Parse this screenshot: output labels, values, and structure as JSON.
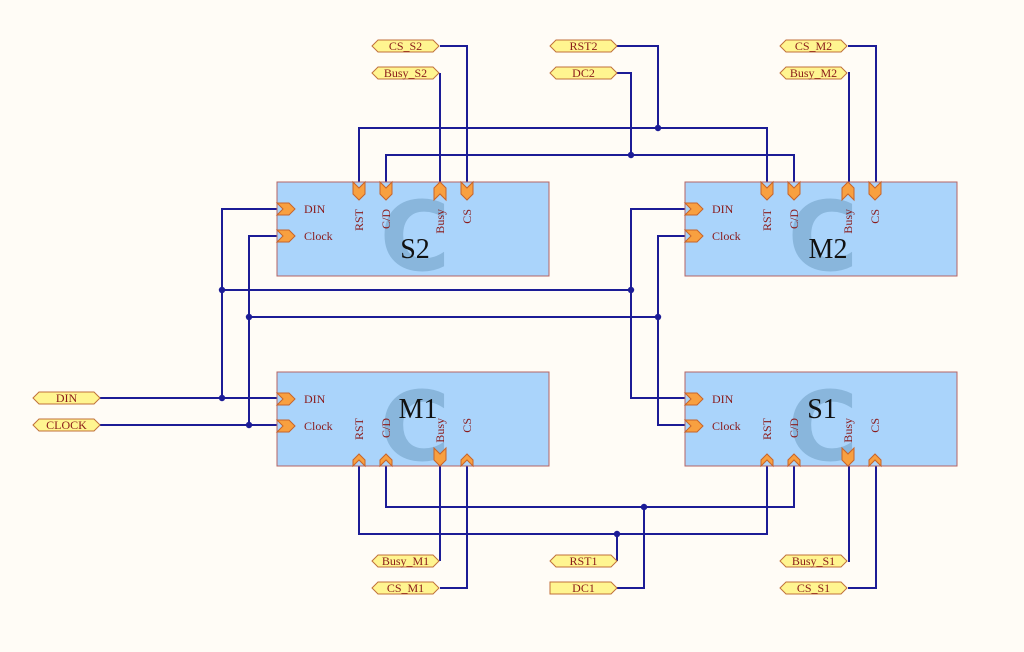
{
  "colors": {
    "wire": "#1c1c96",
    "block_fill": "#aad4fb",
    "block_border": "#b46464",
    "pin": "#f8a040",
    "port_fill": "#fff590",
    "label": "#8a1a1a"
  },
  "watermark": "C",
  "blocks": [
    {
      "name": "S2",
      "pins": {
        "left": [
          "DIN",
          "Clock"
        ],
        "side": [
          "RST",
          "C/D",
          "Busy",
          "CS"
        ]
      }
    },
    {
      "name": "M2",
      "pins": {
        "left": [
          "DIN",
          "Clock"
        ],
        "side": [
          "RST",
          "C/D",
          "Busy",
          "CS"
        ]
      }
    },
    {
      "name": "M1",
      "pins": {
        "left": [
          "DIN",
          "Clock"
        ],
        "side": [
          "RST",
          "C/D",
          "Busy",
          "CS"
        ]
      }
    },
    {
      "name": "S1",
      "pins": {
        "left": [
          "DIN",
          "Clock"
        ],
        "side": [
          "RST",
          "C/D",
          "Busy",
          "CS"
        ]
      }
    }
  ],
  "ports": {
    "cs_s2": "CS_S2",
    "busy_s2": "Busy_S2",
    "rst2": "RST2",
    "dc2": "DC2",
    "cs_m2": "CS_M2",
    "busy_m2": "Busy_M2",
    "din": "DIN",
    "clock": "CLOCK",
    "busy_m1": "Busy_M1",
    "cs_m1": "CS_M1",
    "rst1": "RST1",
    "dc1": "DC1",
    "busy_s1": "Busy_S1",
    "cs_s1": "CS_S1"
  }
}
